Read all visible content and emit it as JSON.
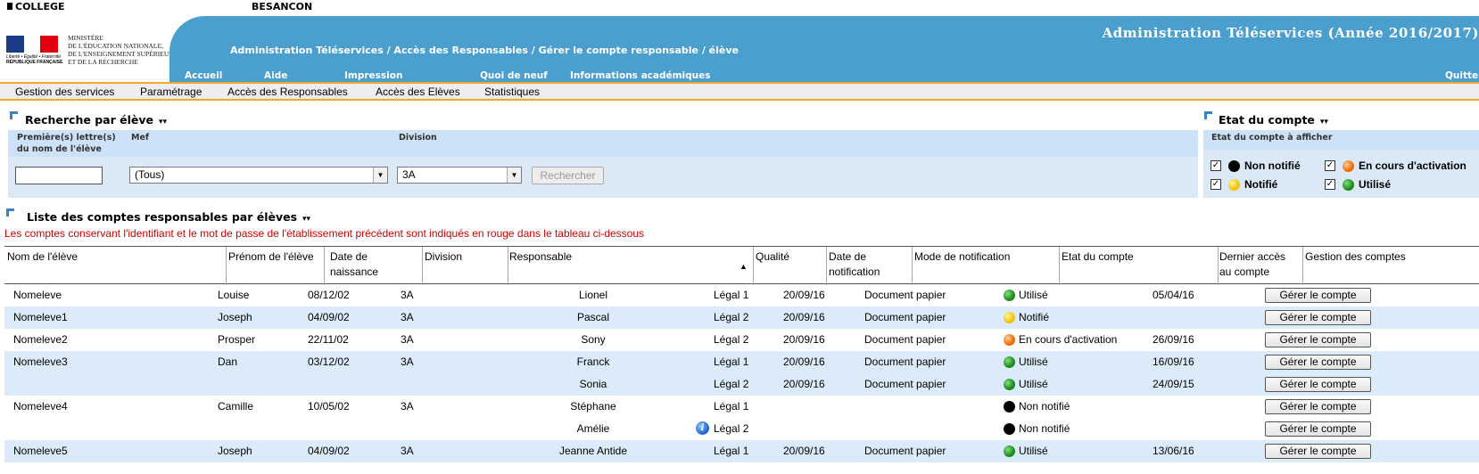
{
  "header": {
    "college": "COLLEGE",
    "city": "BESANCON",
    "ministry_lines": "MINISTÈRE\nDE L'ÉDUCATION NATIONALE,\nDE L'ENSEIGNEMENT SUPÉRIEUR\nET DE LA RECHERCHE",
    "devise": "Liberté • Égalité • Fraternité",
    "republique": "RÉPUBLIQUE FRANÇAISE",
    "app_title": "Administration Téléservices (Année 2016/2017)",
    "breadcrumb": "Administration Téléservices / Accès des Responsables / Gérer le compte responsable / élève",
    "nav": [
      "Accueil",
      "Aide",
      "Impression",
      "Quoi de neuf",
      "Informations académiques",
      "Quitte"
    ]
  },
  "menu": [
    "Gestion des services",
    "Paramétrage",
    "Accès des Responsables",
    "Accès des Elèves",
    "Statistiques"
  ],
  "search": {
    "title": "Recherche par élève",
    "label_name": "Première(s) lettre(s)\ndu nom de l'élève",
    "label_mef": "Mef",
    "label_division": "Division",
    "name_value": "",
    "mef_value": "(Tous)",
    "division_value": "3A",
    "button": "Rechercher"
  },
  "etat": {
    "title": "Etat du compte",
    "subtitle": "Etat du compte à afficher",
    "items": [
      {
        "label": "Non notifié",
        "color": "black",
        "checked": true
      },
      {
        "label": "En cours d'activation",
        "color": "orange",
        "checked": true
      },
      {
        "label": "Notifié",
        "color": "yellow",
        "checked": true
      },
      {
        "label": "Utilisé",
        "color": "green",
        "checked": true
      }
    ]
  },
  "list": {
    "title": "Liste des comptes responsables par élèves",
    "notice": "Les comptes conservant l'identifiant et le mot de passe de l'établissement précédent sont indiqués en rouge dans le tableau ci-dessous",
    "headers": [
      "Nom de l'élève",
      "Prénom de l'élève",
      "Date de\nnaissance",
      "Division",
      "Responsable",
      "Qualité",
      "Date de\nnotification",
      "Mode de notification",
      "Etat du compte",
      "Dernier accès\nau compte",
      "Gestion des comptes"
    ],
    "sort_indicator": "▲",
    "button_label": "Gérer le compte",
    "rows": [
      {
        "nom": "Nomeleve",
        "prenom": "Louise",
        "naissance": "08/12/02",
        "division": "3A",
        "responsable": "Lionel",
        "qualite": "Légal 1",
        "date_notif": "20/09/16",
        "mode": "Document papier",
        "etat": "Utilisé",
        "etat_color": "green",
        "acces": "05/04/16"
      },
      {
        "nom": "Nomeleve1",
        "prenom": "Joseph",
        "naissance": "04/09/02",
        "division": "3A",
        "responsable": "Pascal",
        "qualite": "Légal 2",
        "date_notif": "20/09/16",
        "mode": "Document papier",
        "etat": "Notifié",
        "etat_color": "yellow",
        "acces": ""
      },
      {
        "nom": "Nomeleve2",
        "prenom": "Prosper",
        "naissance": "22/11/02",
        "division": "3A",
        "responsable": "Sony",
        "qualite": "Légal 2",
        "date_notif": "20/09/16",
        "mode": "Document papier",
        "etat": "En cours d'activation",
        "etat_color": "orange",
        "acces": "26/09/16"
      },
      {
        "nom": "Nomeleve3",
        "prenom": "Dan",
        "naissance": "03/12/02",
        "division": "3A",
        "responsable": "Franck",
        "qualite": "Légal 1",
        "date_notif": "20/09/16",
        "mode": "Document papier",
        "etat": "Utilisé",
        "etat_color": "green",
        "acces": "16/09/16"
      },
      {
        "nom": "",
        "prenom": "",
        "naissance": "",
        "division": "",
        "responsable": "Sonia",
        "qualite": "Légal 2",
        "date_notif": "20/09/16",
        "mode": "Document papier",
        "etat": "Utilisé",
        "etat_color": "green",
        "acces": "24/09/15"
      },
      {
        "nom": "Nomeleve4",
        "prenom": "Camille",
        "naissance": "10/05/02",
        "division": "3A",
        "responsable": "Stéphane",
        "qualite": "Légal 1",
        "date_notif": "",
        "mode": "",
        "etat": "Non notifié",
        "etat_color": "black",
        "acces": ""
      },
      {
        "nom": "",
        "prenom": "",
        "naissance": "",
        "division": "",
        "responsable": "Amélie",
        "qualite": "Légal 2",
        "date_notif": "",
        "mode": "",
        "etat": "Non notifié",
        "etat_color": "black",
        "acces": ""
      },
      {
        "nom": "Nomeleve5",
        "prenom": "Joseph",
        "naissance": "04/09/02",
        "division": "3A",
        "responsable": "Jeanne Antide",
        "qualite": "Légal 1",
        "date_notif": "20/09/16",
        "mode": "Document papier",
        "etat": "Utilisé",
        "etat_color": "green",
        "acces": "13/06/16"
      }
    ]
  }
}
